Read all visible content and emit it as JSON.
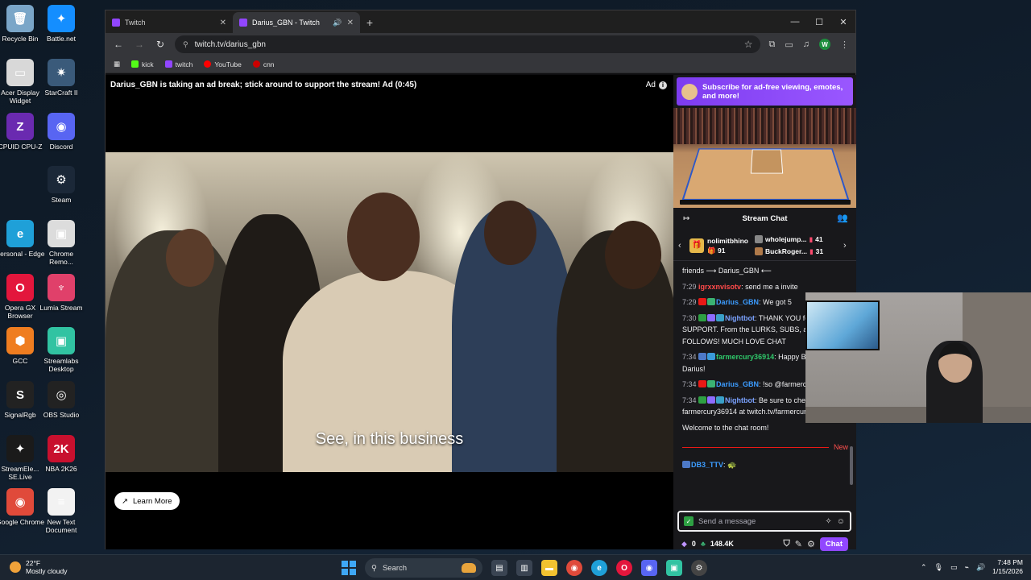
{
  "desktop": {
    "icons": [
      {
        "label": "Recycle Bin",
        "glyph": "🗑",
        "color": "#7aa6c8"
      },
      {
        "label": "Battle.net",
        "glyph": "✦",
        "color": "#148eff"
      },
      {
        "label": "Acer Display Widget",
        "glyph": "▭",
        "color": "#d8d8d8"
      },
      {
        "label": "StarCraft II",
        "glyph": "✷",
        "color": "#3a5a7a"
      },
      {
        "label": "CPUID CPU-Z",
        "glyph": "Z",
        "color": "#6a2ab0"
      },
      {
        "label": "Discord",
        "glyph": "◉",
        "color": "#5865f2"
      },
      {
        "label": "Steam",
        "glyph": "⚙",
        "color": "#1b2838"
      },
      {
        "label": "Personal - Edge",
        "glyph": "e",
        "color": "#1fa0d8"
      },
      {
        "label": "Chrome Remo...",
        "glyph": "▣",
        "color": "#dcdcdc"
      },
      {
        "label": "Opera GX Browser",
        "glyph": "O",
        "color": "#e3163c"
      },
      {
        "label": "Lumia Stream",
        "glyph": "♆",
        "color": "#e0406a"
      },
      {
        "label": "GCC",
        "glyph": "⬢",
        "color": "#ef7d20"
      },
      {
        "label": "Streamlabs Desktop",
        "glyph": "▣",
        "color": "#31c3a2"
      },
      {
        "label": "SignalRgb",
        "glyph": "S",
        "color": "#222"
      },
      {
        "label": "OBS Studio",
        "glyph": "◎",
        "color": "#222"
      },
      {
        "label": "StreamEle... SE.Live",
        "glyph": "✦",
        "color": "#1a1a1a"
      },
      {
        "label": "NBA 2K26",
        "glyph": "2K",
        "color": "#c8102e"
      },
      {
        "label": "Google Chrome",
        "glyph": "◉",
        "color": "#e04a3a"
      },
      {
        "label": "New Text Document",
        "glyph": "≡",
        "color": "#f2f2f2"
      }
    ]
  },
  "browser": {
    "tabs": [
      {
        "title": "Twitch"
      },
      {
        "title": "Darius_GBN - Twitch"
      }
    ],
    "url": "twitch.tv/darius_gbn",
    "profile_initial": "W",
    "bookmarks": [
      {
        "label": "kick",
        "color": "#53fc18"
      },
      {
        "label": "twitch",
        "color": "#9146ff"
      },
      {
        "label": "YouTube",
        "color": "#ff0000"
      },
      {
        "label": "cnn",
        "color": "#cc0000"
      }
    ]
  },
  "player": {
    "ad_banner": "Darius_GBN is taking an ad break; stick around to support the stream! Ad (0:45)",
    "ad_label": "Ad",
    "subtitle": "See, in this business",
    "learn_more": "Learn More"
  },
  "chat": {
    "promo": "Subscribe for ad-free viewing, emotes, and more!",
    "title": "Stream Chat",
    "gift_leader": {
      "name": "nolimitbhino",
      "count": "91"
    },
    "gift_list": [
      {
        "name": "wholejump...",
        "count": "41"
      },
      {
        "name": "BuckRoger...",
        "count": "31"
      }
    ],
    "messages": [
      {
        "time": "",
        "user": "",
        "color": "#efeff1",
        "text": "friends ⟶ Darius_GBN ⟵",
        "badges": []
      },
      {
        "time": "7:29",
        "user": "igrxxnvisotv",
        "color": "#ff4a4a",
        "text": ": send me a invite",
        "badges": []
      },
      {
        "time": "7:29",
        "user": "Darius_GBN",
        "color": "#3c9cff",
        "text": ": We got 5",
        "badges": [
          "#e91916",
          "#3bb273"
        ]
      },
      {
        "time": "7:30",
        "user": "Nightbot",
        "color": "#7aa2ff",
        "text": ": THANK YOU for all of your SUPPORT. From the LURKS, SUBS, and FOLLOWS! MUCH LOVE CHAT",
        "badges": [
          "#2ea043",
          "#8e6cff",
          "#3aa0c8"
        ]
      },
      {
        "time": "7:34",
        "user": "farmercury36914",
        "color": "#2fc86a",
        "text": ": Happy Birthday Darius!",
        "badges": [
          "#4d79c7",
          "#3a9ad9"
        ]
      },
      {
        "time": "7:34",
        "user": "Darius_GBN",
        "color": "#3c9cff",
        "text": ": !so @farmercury36914",
        "badges": [
          "#e91916",
          "#3bb273"
        ]
      },
      {
        "time": "7:34",
        "user": "Nightbot",
        "color": "#7aa2ff",
        "text": ": Be sure to check out farmercury36914 at twitch.tv/farmercury36914",
        "badges": [
          "#2ea043",
          "#8e6cff",
          "#3aa0c8"
        ]
      }
    ],
    "system_message": "Welcome to the chat room!",
    "new_label": "New",
    "after_new": {
      "user": "DB3_TTV",
      "color": "#3c9cff",
      "text": ": 🐢"
    },
    "input_placeholder": "Send a message",
    "points": "0",
    "bits": "148.4K",
    "send_label": "Chat"
  },
  "taskbar": {
    "weather_temp": "22°F",
    "weather_desc": "Mostly cloudy",
    "search": "Search",
    "time": "7:48 PM",
    "date": "1/15/2026"
  }
}
